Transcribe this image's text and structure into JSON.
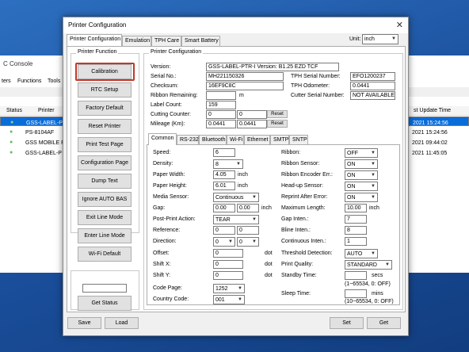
{
  "background": {
    "title": "C Console",
    "menu": [
      "ters",
      "Functions",
      "Tools"
    ],
    "headers": {
      "status": "Status",
      "printer": "Printer",
      "update": "st Update Time"
    },
    "rows": [
      {
        "printer": "GSS-LABEL-P",
        "time": "2021 15:24:56",
        "selected": true
      },
      {
        "printer": "PS-8104AF",
        "time": "2021 15:24:56",
        "selected": false
      },
      {
        "printer": "GSS MOBILE P",
        "time": "2021 09:44:02",
        "selected": false
      },
      {
        "printer": "GSS-LABEL-P",
        "time": "2021 11:45:05",
        "selected": false
      }
    ]
  },
  "dialog": {
    "title": "Printer Configuration",
    "close": "✕",
    "top_tabs": [
      "Printer Configuration",
      "Emulation",
      "TPH Care",
      "Smart Battery"
    ],
    "unit_label": "Unit:",
    "unit_value": "inch",
    "printer_function": {
      "label": "Printer Function",
      "buttons": [
        "Calibration",
        "RTC Setup",
        "Factory Default",
        "Reset Printer",
        "Print Test Page",
        "Configuration Page",
        "Dump Text",
        "Ignore AUTO BAS",
        "Exit Line Mode",
        "Enter Line Mode",
        "Wi-Fi Default"
      ],
      "get_status": "Get Status"
    },
    "config": {
      "label": "Printer Configuration",
      "version_label": "Version:",
      "version": "GSS-LABEL-PTR-I Version: B1.25 EZD TCF",
      "serial_label": "Serial No.:",
      "serial": "MH221150326",
      "tph_serial_label": "TPH Serial Number:",
      "tph_serial": "EFO1200237",
      "checksum_label": "Checksum:",
      "checksum": "16EF9C8C",
      "tph_odo_label": "TPH Odometer:",
      "tph_odo": "0.0441",
      "ribbon_rem_label": "Ribbon Remaining:",
      "ribbon_rem_unit": "m",
      "cutter_serial_label": "Cutter Serial Number:",
      "cutter_serial": "NOT AVAILABLE",
      "label_count_label": "Label Count:",
      "label_count": "159",
      "cutting_label": "Cutting Counter:",
      "cutting_a": "0",
      "cutting_b": "0",
      "mileage_label": "Mileage (Km):",
      "mileage_a": "0.0441",
      "mileage_b": "0.0441",
      "reset": "Reset"
    },
    "sub_tabs": [
      "Common",
      "RS-232",
      "Bluetooth",
      "Wi-Fi",
      "Ethernet",
      "SMTP",
      "SNTP"
    ],
    "common": {
      "speed_label": "Speed:",
      "speed": "6",
      "density_label": "Density:",
      "density": "8",
      "paper_width_label": "Paper Width:",
      "paper_width": "4.05",
      "paper_width_unit": "inch",
      "paper_height_label": "Paper Height:",
      "paper_height": "6.01",
      "paper_height_unit": "inch",
      "media_label": "Media Sensor:",
      "media": "Continuous",
      "gap_label": "Gap:",
      "gap_a": "0.00",
      "gap_b": "0.00",
      "gap_unit": "inch",
      "post_print_label": "Post-Print Action:",
      "post_print": "TEAR",
      "reference_label": "Reference:",
      "reference_a": "0",
      "reference_b": "0",
      "direction_label": "Direction:",
      "direction_a": "0",
      "direction_b": "0",
      "offset_label": "Offset:",
      "offset": "0",
      "offset_unit": "dot",
      "shiftx_label": "Shift X:",
      "shiftx": "0",
      "shiftx_unit": "dot",
      "shifty_label": "Shift Y:",
      "shifty": "0",
      "shifty_unit": "dot",
      "codepage_label": "Code Page:",
      "codepage": "1252",
      "country_label": "Country Code:",
      "country": "001",
      "ribbon_label": "Ribbon:",
      "ribbon": "OFF",
      "ribbon_sensor_label": "Ribbon Sensor:",
      "ribbon_sensor": "ON",
      "ribbon_enc_label": "Ribbon Encoder Err.:",
      "ribbon_enc": "ON",
      "headup_label": "Head-up Sensor:",
      "headup": "ON",
      "reprint_label": "Reprint After Error:",
      "reprint": "ON",
      "max_len_label": "Maximum Length:",
      "max_len": "10.00",
      "max_len_unit": "inch",
      "gap_inten_label": "Gap Inten.:",
      "gap_inten": "7",
      "bline_label": "Bline Inten.:",
      "bline": "8",
      "cont_inten_label": "Continuous Inten.:",
      "cont_inten": "1",
      "threshold_label": "Threshold Detection:",
      "threshold": "AUTO",
      "quality_label": "Print Quality:",
      "quality": "STANDARD",
      "standby_label": "Standby Time:",
      "standby_unit": "secs",
      "standby_hint": "(1~65534, 0: OFF)",
      "sleep_label": "Sleep Time:",
      "sleep_unit": "mins",
      "sleep_hint": "(10~65534, 0: OFF)"
    },
    "footer": {
      "save": "Save",
      "load": "Load",
      "set": "Set",
      "get": "Get"
    }
  }
}
